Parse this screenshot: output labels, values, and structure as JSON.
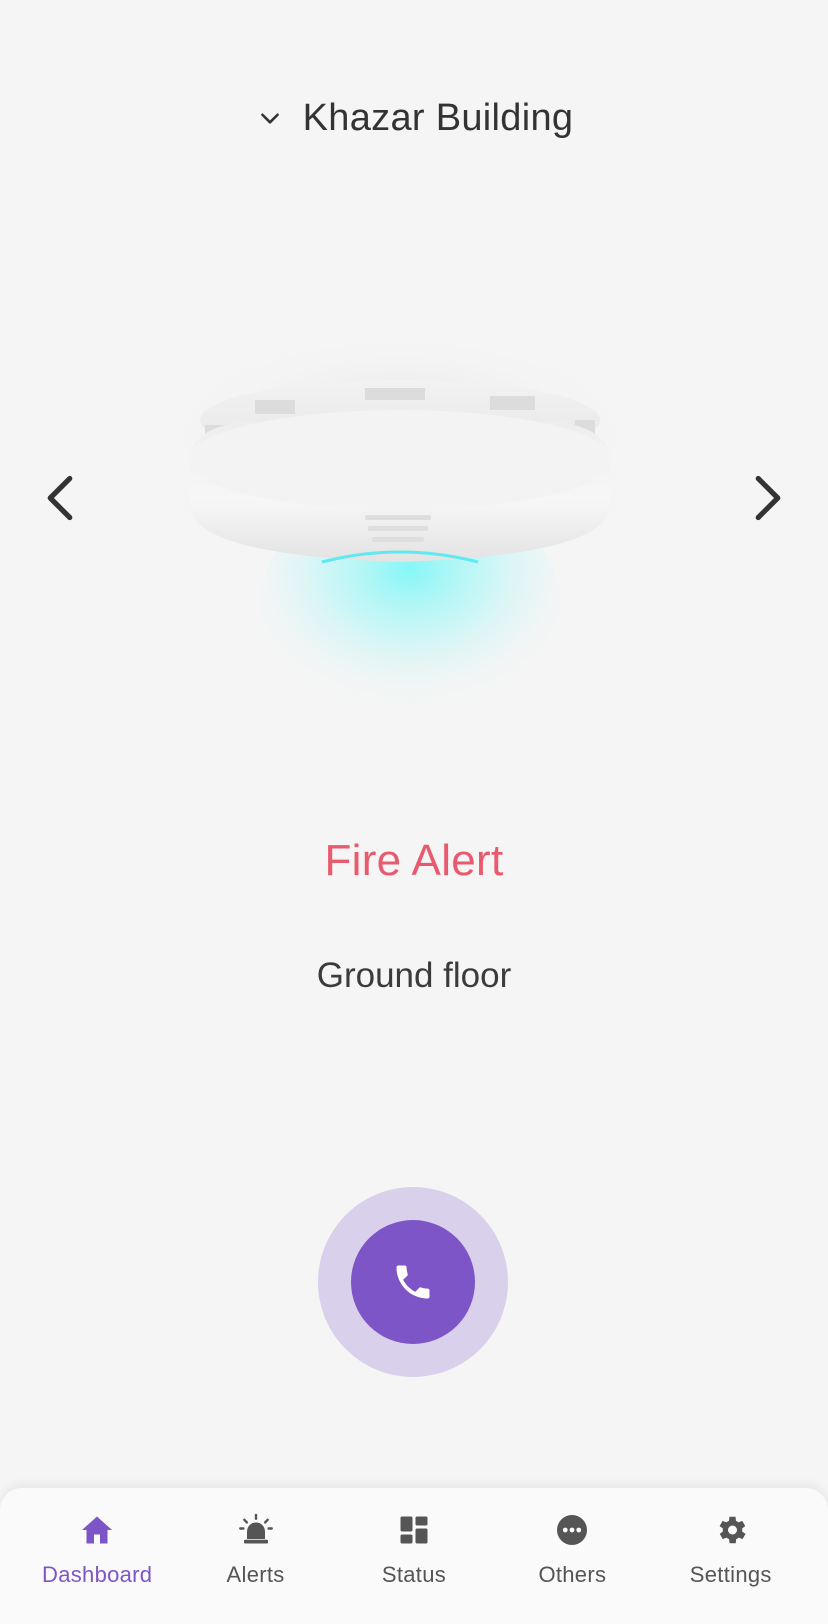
{
  "header": {
    "building_name": "Khazar Building",
    "dropdown_icon": "chevron-down-icon"
  },
  "device": {
    "image": "smoke-detector-illustration",
    "prev_icon": "chevron-left-icon",
    "next_icon": "chevron-right-icon"
  },
  "alert": {
    "title": "Fire Alert",
    "location": "Ground floor"
  },
  "call_button": {
    "icon": "phone-icon"
  },
  "colors": {
    "accent": "#7e55c6",
    "accent_light": "#d9d0ec",
    "alert": "#e85b6e",
    "glow": "#7ff7f7",
    "background": "#f5f5f5"
  },
  "bottom_nav": {
    "items": [
      {
        "label": "Dashboard",
        "icon": "home-icon",
        "active": true
      },
      {
        "label": "Alerts",
        "icon": "siren-icon",
        "active": false
      },
      {
        "label": "Status",
        "icon": "grid-icon",
        "active": false
      },
      {
        "label": "Others",
        "icon": "more-dots-icon",
        "active": false
      },
      {
        "label": "Settings",
        "icon": "gear-icon",
        "active": false
      }
    ]
  }
}
